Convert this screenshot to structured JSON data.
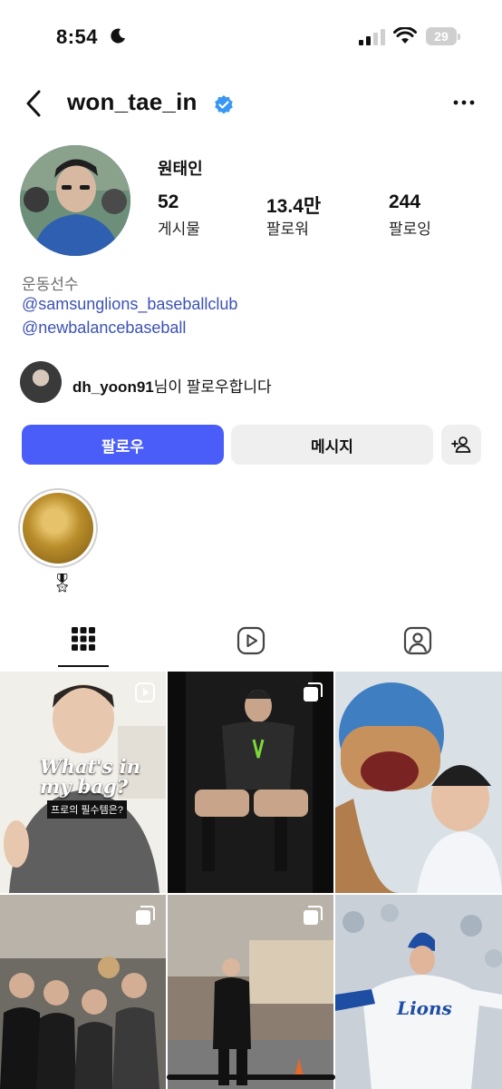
{
  "status_bar": {
    "time": "8:54",
    "battery": "29"
  },
  "header": {
    "username": "won_tae_in"
  },
  "profile": {
    "display_name": "원태인",
    "stats": [
      {
        "value": "52",
        "label": "게시물"
      },
      {
        "value": "13.4만",
        "label": "팔로워"
      },
      {
        "value": "244",
        "label": "팔로잉"
      }
    ],
    "category": "운동선수",
    "links": [
      "@samsunglions_baseballclub",
      "@newbalancebaseball"
    ],
    "followed_by": {
      "user": "dh_yoon91",
      "suffix": "님이 팔로우합니다"
    }
  },
  "actions": {
    "follow": "팔로우",
    "message": "메시지"
  },
  "highlight": {
    "label": "🎖"
  },
  "tabs": [
    "grid-icon",
    "reels-icon",
    "tagged-icon"
  ],
  "grid": [
    {
      "name": "post-whats-in-my-bag",
      "icon": "reel-icon",
      "overlay_lines": [
        "What's in",
        "my bag?",
        "프로의 필수템은?"
      ]
    },
    {
      "name": "post-gym-photo",
      "icon": "carousel-icon"
    },
    {
      "name": "post-mascot-photo",
      "icon": "none"
    },
    {
      "name": "post-group-photo",
      "icon": "carousel-icon"
    },
    {
      "name": "post-street-photo",
      "icon": "carousel-icon"
    },
    {
      "name": "post-pitching-photo",
      "icon": "none"
    }
  ],
  "colors": {
    "accent": "#4a5df9",
    "link": "#3c52b7",
    "verified": "#3897f0"
  }
}
